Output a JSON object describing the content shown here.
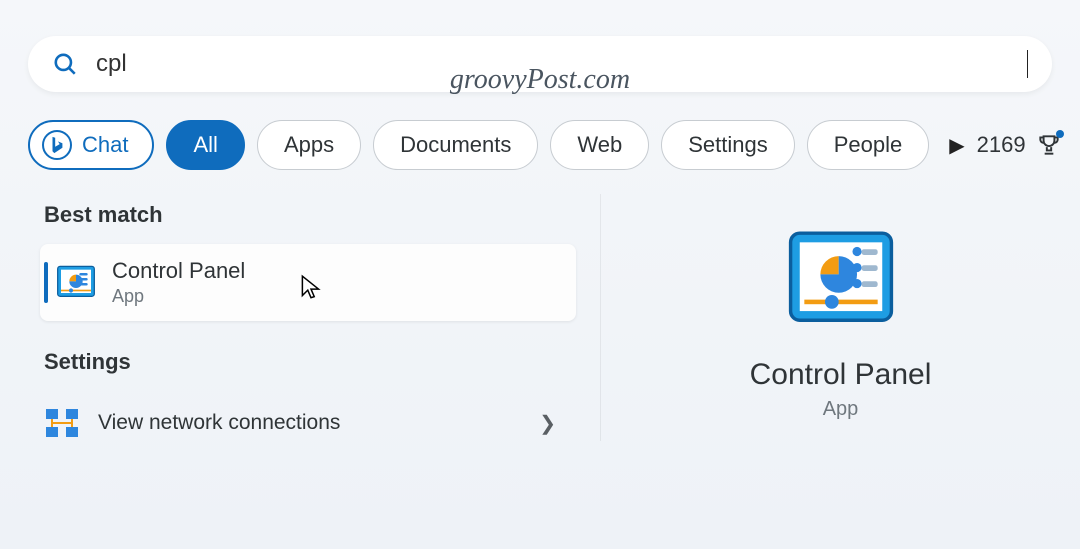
{
  "watermark": "groovyPost.com",
  "search": {
    "query": "cpl"
  },
  "filters": {
    "chat": "Chat",
    "items": [
      "All",
      "Apps",
      "Documents",
      "Web",
      "Settings",
      "People"
    ],
    "active_index": 0
  },
  "rewards": {
    "points": "2169"
  },
  "left": {
    "best_match_header": "Best match",
    "best_match": {
      "title": "Control Panel",
      "subtitle": "App"
    },
    "settings_header": "Settings",
    "settings_item": "View network connections"
  },
  "detail": {
    "title": "Control Panel",
    "subtitle": "App"
  }
}
